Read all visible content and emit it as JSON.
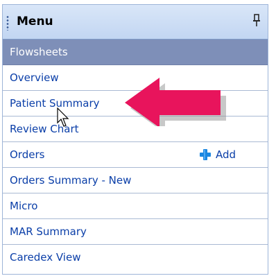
{
  "menu": {
    "title": "Menu",
    "items": [
      {
        "label": "Flowsheets",
        "selected": true
      },
      {
        "label": "Overview"
      },
      {
        "label": "Patient Summary"
      },
      {
        "label": "Review Chart"
      },
      {
        "label": "Orders",
        "action_label": "Add"
      },
      {
        "label": "Orders Summary - New"
      },
      {
        "label": "Micro"
      },
      {
        "label": "MAR Summary"
      },
      {
        "label": "Caredex View"
      }
    ]
  },
  "icons": {
    "pin": "pin-icon",
    "add": "plus-icon",
    "grip": "grip-icon",
    "arrow": "left-arrow-annotation",
    "cursor": "mouse-pointer"
  },
  "colors": {
    "header_bg": "#c2d6f2",
    "selected_bg": "#7e8fb8",
    "link_text": "#0a3ea8",
    "arrow": "#e8145c",
    "plus": "#1a86e0"
  }
}
